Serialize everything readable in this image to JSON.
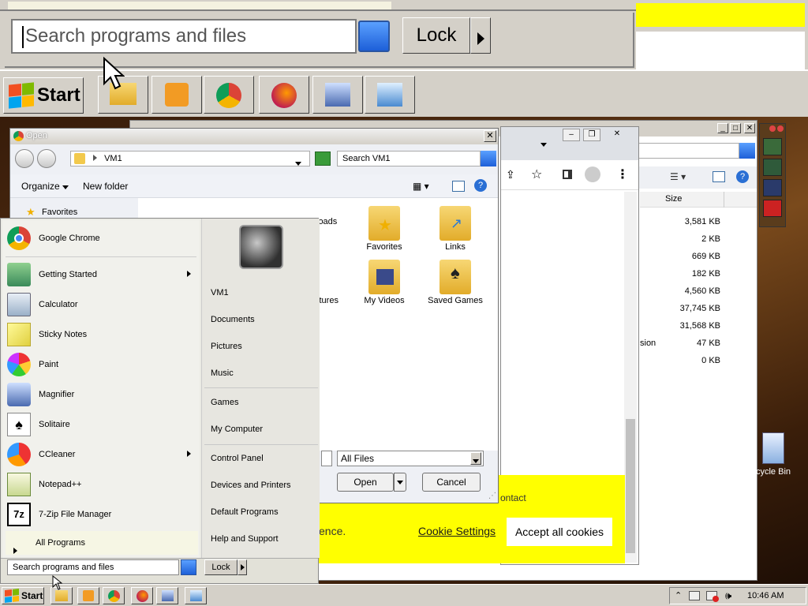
{
  "zoom": {
    "search_placeholder": "Search programs and files",
    "lock_label": "Lock",
    "start_label": "Start"
  },
  "open_dialog": {
    "title": "Open",
    "path": "VM1",
    "search_placeholder": "Search VM1",
    "organize_label": "Organize",
    "new_folder_label": "New folder",
    "nav_favorites": "Favorites",
    "folders": [
      {
        "name": "Favorites"
      },
      {
        "name": "Links"
      },
      {
        "name": "My Videos"
      },
      {
        "name": "Saved Games"
      }
    ],
    "partial_labels": [
      "loads",
      "ctures"
    ],
    "filter_value": "All Files",
    "open_label": "Open",
    "cancel_label": "Cancel"
  },
  "background_window": {
    "column_size": "Size",
    "sizes": [
      "3,581 KB",
      "2 KB",
      "669 KB",
      "182 KB",
      "4,560 KB",
      "37,745 KB",
      "31,568 KB",
      "47 KB",
      "0 KB"
    ],
    "partial_name": "sion"
  },
  "chrome": {
    "cookie_contact": "ontact",
    "cookie_partial": "ence.",
    "cookie_settings": "Cookie Settings",
    "accept_cookies": "Accept all cookies"
  },
  "start_menu": {
    "programs": [
      {
        "label": "Google Chrome",
        "icon": "chrome-icon",
        "submenu": false
      },
      {
        "label": "Getting Started",
        "icon": "getting-started-icon",
        "submenu": true
      },
      {
        "label": "Calculator",
        "icon": "calculator-icon",
        "submenu": false
      },
      {
        "label": "Sticky Notes",
        "icon": "sticky-notes-icon",
        "submenu": false
      },
      {
        "label": "Paint",
        "icon": "paint-icon",
        "submenu": false
      },
      {
        "label": "Magnifier",
        "icon": "magnifier-icon",
        "submenu": false
      },
      {
        "label": "Solitaire",
        "icon": "solitaire-icon",
        "submenu": false
      },
      {
        "label": "CCleaner",
        "icon": "ccleaner-icon",
        "submenu": true
      },
      {
        "label": "Notepad++",
        "icon": "notepadpp-icon",
        "submenu": false
      },
      {
        "label": "7-Zip File Manager",
        "icon": "7zip-icon",
        "submenu": false
      }
    ],
    "all_programs": "All Programs",
    "right_links": [
      "VM1",
      "Documents",
      "Pictures",
      "Music",
      "Games",
      "My Computer",
      "Control Panel",
      "Devices and Printers",
      "Default Programs",
      "Help and Support"
    ],
    "search_placeholder": "Search programs and files",
    "lock_label": "Lock"
  },
  "taskbar": {
    "start_label": "Start",
    "clock": "10:46 AM"
  },
  "desktop": {
    "recycle_bin": "cycle Bin"
  }
}
